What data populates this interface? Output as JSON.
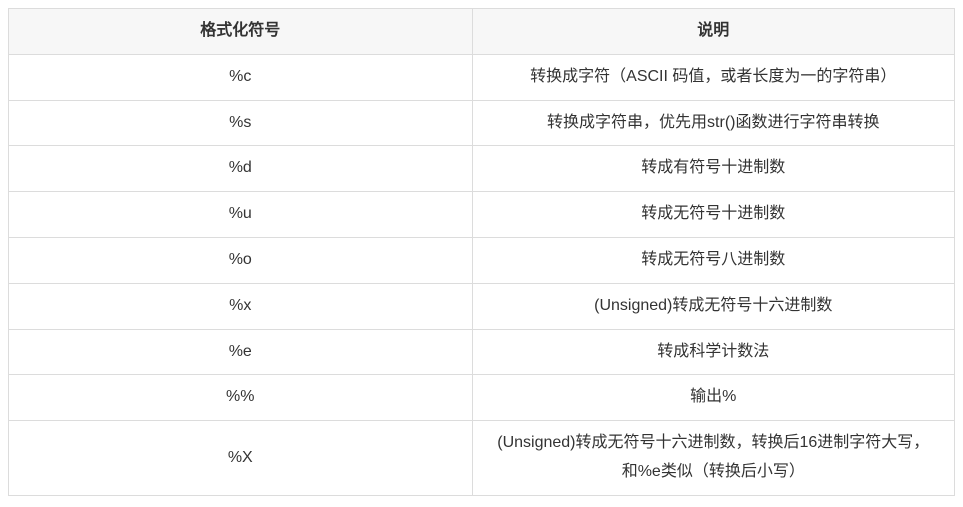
{
  "table": {
    "headers": [
      "格式化符号",
      "说明"
    ],
    "rows": [
      {
        "symbol": "%c",
        "desc": "转换成字符（ASCII 码值，或者长度为一的字符串）"
      },
      {
        "symbol": "%s",
        "desc": "转换成字符串，优先用str()函数进行字符串转换"
      },
      {
        "symbol": "%d",
        "desc": "转成有符号十进制数"
      },
      {
        "symbol": "%u",
        "desc": "转成无符号十进制数"
      },
      {
        "symbol": "%o",
        "desc": "转成无符号八进制数"
      },
      {
        "symbol": "%x",
        "desc": "(Unsigned)转成无符号十六进制数"
      },
      {
        "symbol": "%e",
        "desc": "转成科学计数法"
      },
      {
        "symbol": "%%",
        "desc": "输出%"
      },
      {
        "symbol": "%X",
        "desc": "(Unsigned)转成无符号十六进制数，转换后16进制字符大写，和%e类似（转换后小写）"
      }
    ]
  }
}
